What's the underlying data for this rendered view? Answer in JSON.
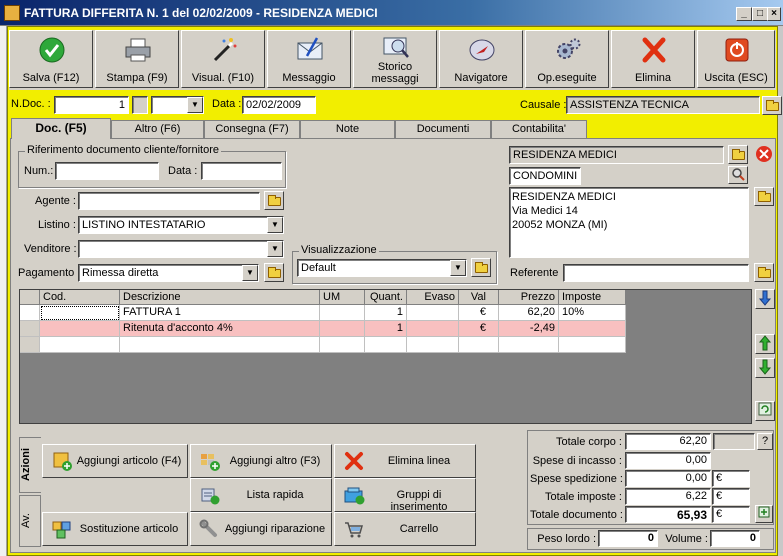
{
  "window": {
    "title": "FATTURA DIFFERITA N. 1  del 02/02/2009 - RESIDENZA MEDICI"
  },
  "toolbar": [
    {
      "label": "Salva (F12)",
      "icon": "check-icon"
    },
    {
      "label": "Stampa (F9)",
      "icon": "printer-icon"
    },
    {
      "label": "Visual. (F10)",
      "icon": "magic-wand-icon"
    },
    {
      "label": "Messaggio",
      "icon": "envelope-pen-icon"
    },
    {
      "label": "Storico messaggi",
      "icon": "message-history-icon"
    },
    {
      "label": "Navigatore",
      "icon": "compass-icon"
    },
    {
      "label": "Op.eseguite",
      "icon": "gears-icon"
    },
    {
      "label": "Elimina",
      "icon": "delete-x-icon"
    },
    {
      "label": "Uscita (ESC)",
      "icon": "exit-icon"
    }
  ],
  "header": {
    "ndoc_label": "N.Doc. :",
    "ndoc_value": "1",
    "data_label": "Data :",
    "data_value": "02/02/2009",
    "causale_label": "Causale :",
    "causale_value": "ASSISTENZA TECNICA"
  },
  "tabs": [
    "Doc. (F5)",
    "Altro (F6)",
    "Consegna (F7)",
    "Note",
    "Documenti",
    "Contabilita'"
  ],
  "riferimento": {
    "title": "Riferimento documento cliente/fornitore",
    "num_label": "Num.:",
    "num_value": "",
    "data_label": "Data :",
    "data_value": ""
  },
  "fields": {
    "agente_label": "Agente :",
    "agente_value": "",
    "listino_label": "Listino :",
    "listino_value": "LISTINO INTESTATARIO",
    "venditore_label": "Venditore :",
    "venditore_value": "",
    "pagamento_label": "Pagamento :",
    "pagamento_value": "Rimessa diretta",
    "visualizzazione_title": "Visualizzazione",
    "visualizzazione_value": "Default"
  },
  "cliente": {
    "name": "RESIDENZA MEDICI",
    "type": "CONDOMINI",
    "address_lines": [
      "RESIDENZA MEDICI",
      "Via Medici 14",
      "20052 MONZA (MI)"
    ],
    "referente_label": "Referente",
    "referente_value": ""
  },
  "grid": {
    "columns": [
      "Cod.",
      "Descrizione",
      "UM",
      "Quant.",
      "Evaso",
      "Val",
      "Prezzo",
      "Imposte"
    ],
    "rows": [
      {
        "cod": "",
        "descrizione": "FATTURA 1",
        "um": "",
        "quant": "1",
        "evaso": "",
        "val": "€",
        "prezzo": "62,20",
        "imposte": "10%"
      },
      {
        "cod": "",
        "descrizione": "Ritenuta d'acconto 4%",
        "um": "",
        "quant": "1",
        "evaso": "",
        "val": "€",
        "prezzo": "-2,49",
        "imposte": ""
      },
      {
        "cod": "",
        "descrizione": "",
        "um": "",
        "quant": "",
        "evaso": "",
        "val": "",
        "prezzo": "",
        "imposte": ""
      }
    ]
  },
  "actions": {
    "tab_azioni": "Azioni",
    "tab_av": "Av.",
    "buttons": [
      {
        "label": "Aggiungi articolo (F4)",
        "icon": "add-article-icon"
      },
      {
        "label": "Aggiungi altro (F3)",
        "icon": "add-other-icon"
      },
      {
        "label": "Elimina linea",
        "icon": "delete-line-icon"
      },
      {
        "label": "Lista rapida",
        "icon": "quick-list-icon"
      },
      {
        "label": "Gruppi di inserimento",
        "icon": "insert-groups-icon"
      },
      {
        "label": "Sostituzione articolo",
        "icon": "replace-article-icon"
      },
      {
        "label": "Aggiungi riparazione",
        "icon": "repair-icon"
      },
      {
        "label": "Carrello",
        "icon": "cart-icon"
      }
    ]
  },
  "totals": {
    "corpo_label": "Totale corpo :",
    "corpo_value": "62,20",
    "incasso_label": "Spese di incasso :",
    "incasso_value": "0,00",
    "spedizione_label": "Spese spedizione :",
    "spedizione_value": "0,00",
    "imposte_label": "Totale imposte :",
    "imposte_value": "6,22",
    "documento_label": "Totale documento :",
    "documento_value": "65,93",
    "currency": "€",
    "help": "?",
    "peso_label": "Peso lordo :",
    "peso_value": "0",
    "volume_label": "Volume :",
    "volume_value": "0"
  }
}
